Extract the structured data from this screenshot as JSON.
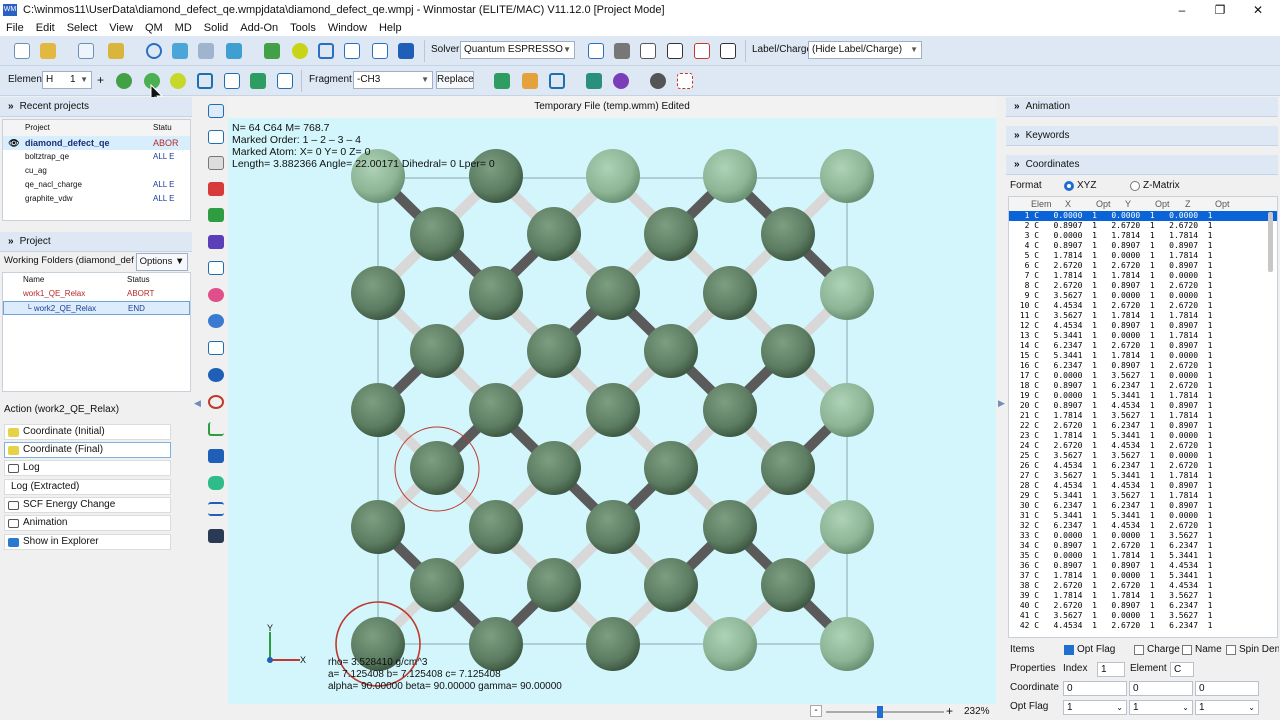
{
  "window": {
    "app_icon": "WM",
    "title": "C:\\winmos11\\UserData\\diamond_defect_qe.wmpjdata\\diamond_defect_qe.wmpj - Winmostar (ELITE/MAC) V11.12.0 [Project Mode]",
    "minimize": "–",
    "maximize": "❐",
    "close": "✕"
  },
  "menu": [
    "File",
    "Edit",
    "Select",
    "View",
    "QM",
    "MD",
    "Solid",
    "Add-On",
    "Tools",
    "Window",
    "Help"
  ],
  "toolbar1": {
    "solver_label": "Solver",
    "solver_value": "Quantum ESPRESSO",
    "label_charge_label": "Label/Charge",
    "label_charge_value": "(Hide Label/Charge)"
  },
  "toolbar2": {
    "element_label": "Element",
    "element_value": "H",
    "element_count": "1",
    "plus": "+",
    "fragment_label": "Fragment",
    "fragment_value": "-CH3",
    "replace_label": "Replace"
  },
  "recent_projects": {
    "header": "Recent projects",
    "col_project": "Project",
    "col_status": "Statu",
    "items": [
      {
        "name": "diamond_defect_qe",
        "status": "ABOR"
      },
      {
        "name": "boltztrap_qe",
        "status": "ALL E"
      },
      {
        "name": "cu_ag",
        "status": ""
      },
      {
        "name": "qe_nacl_charge",
        "status": "ALL E"
      },
      {
        "name": "graphite_vdw",
        "status": "ALL E"
      }
    ]
  },
  "project": {
    "header": "Project",
    "working_folders": "Working Folders (diamond_defe",
    "options": "Options ▼",
    "col_name": "Name",
    "col_status": "Status",
    "items": [
      {
        "name": "work1_QE_Relax",
        "status": "ABORT"
      },
      {
        "name": "└ work2_QE_Relax",
        "status": "END"
      }
    ]
  },
  "actions": {
    "header": "Action (work2_QE_Relax)",
    "items": [
      "Coordinate (Initial)",
      "Coordinate (Final)",
      "Log",
      "Log (Extracted)",
      "SCF Energy Change",
      "Animation",
      "Show in Explorer"
    ]
  },
  "viewport": {
    "title": "Temporary File (temp.wmm) Edited",
    "info_lines": [
      "N= 64  C64  M= 768.7",
      "Marked Order: 1 – 2 – 3 – 4",
      "Marked Atom:  X= 0  Y= 0  Z= 0",
      "Length= 3.882366  Angle= 22.00171  Dihedral= 0  Lper= 0"
    ],
    "cell_lines": [
      "rho= 3.528410 g/cm^3",
      "a= 7.125408  b= 7.125408  c= 7.125408",
      "alpha= 90.00000  beta= 90.00000  gamma= 90.00000"
    ],
    "axis_y": "Y",
    "axis_x": "X",
    "zoom": "232%",
    "zoom_minus": "-",
    "zoom_plus": "+",
    "zoom_fraction": 0.43
  },
  "right_panel": {
    "animation": "Animation",
    "keywords": "Keywords",
    "coordinates": "Coordinates",
    "format_label": "Format",
    "format_xyz": "XYZ",
    "format_zmatrix": "Z-Matrix",
    "table_headers": [
      "Elem",
      "X",
      "Opt",
      "Y",
      "Opt",
      "Z",
      "Opt"
    ],
    "rows": [
      [
        "1",
        "C",
        "0.0000",
        "0.0000",
        "0.0000"
      ],
      [
        "2",
        "C",
        "0.8907",
        "2.6720",
        "2.6720"
      ],
      [
        "3",
        "C",
        "0.0000",
        "1.7814",
        "1.7814"
      ],
      [
        "4",
        "C",
        "0.8907",
        "0.8907",
        "0.8907"
      ],
      [
        "5",
        "C",
        "1.7814",
        "0.0000",
        "1.7814"
      ],
      [
        "6",
        "C",
        "2.6720",
        "2.6720",
        "0.8907"
      ],
      [
        "7",
        "C",
        "1.7814",
        "1.7814",
        "0.0000"
      ],
      [
        "8",
        "C",
        "2.6720",
        "0.8907",
        "2.6720"
      ],
      [
        "9",
        "C",
        "3.5627",
        "0.0000",
        "0.0000"
      ],
      [
        "10",
        "C",
        "4.4534",
        "2.6720",
        "2.6720"
      ],
      [
        "11",
        "C",
        "3.5627",
        "1.7814",
        "1.7814"
      ],
      [
        "12",
        "C",
        "4.4534",
        "0.8907",
        "0.8907"
      ],
      [
        "13",
        "C",
        "5.3441",
        "0.0000",
        "1.7814"
      ],
      [
        "14",
        "C",
        "6.2347",
        "2.6720",
        "0.8907"
      ],
      [
        "15",
        "C",
        "5.3441",
        "1.7814",
        "0.0000"
      ],
      [
        "16",
        "C",
        "6.2347",
        "0.8907",
        "2.6720"
      ],
      [
        "17",
        "C",
        "0.0000",
        "3.5627",
        "0.0000"
      ],
      [
        "18",
        "C",
        "0.8907",
        "6.2347",
        "2.6720"
      ],
      [
        "19",
        "C",
        "0.0000",
        "5.3441",
        "1.7814"
      ],
      [
        "20",
        "C",
        "0.8907",
        "4.4534",
        "0.8907"
      ],
      [
        "21",
        "C",
        "1.7814",
        "3.5627",
        "1.7814"
      ],
      [
        "22",
        "C",
        "2.6720",
        "6.2347",
        "0.8907"
      ],
      [
        "23",
        "C",
        "1.7814",
        "5.3441",
        "0.0000"
      ],
      [
        "24",
        "C",
        "2.6720",
        "4.4534",
        "2.6720"
      ],
      [
        "25",
        "C",
        "3.5627",
        "3.5627",
        "0.0000"
      ],
      [
        "26",
        "C",
        "4.4534",
        "6.2347",
        "2.6720"
      ],
      [
        "27",
        "C",
        "3.5627",
        "5.3441",
        "1.7814"
      ],
      [
        "28",
        "C",
        "4.4534",
        "4.4534",
        "0.8907"
      ],
      [
        "29",
        "C",
        "5.3441",
        "3.5627",
        "1.7814"
      ],
      [
        "30",
        "C",
        "6.2347",
        "6.2347",
        "0.8907"
      ],
      [
        "31",
        "C",
        "5.3441",
        "5.3441",
        "0.0000"
      ],
      [
        "32",
        "C",
        "6.2347",
        "4.4534",
        "2.6720"
      ],
      [
        "33",
        "C",
        "0.0000",
        "0.0000",
        "3.5627"
      ],
      [
        "34",
        "C",
        "0.8907",
        "2.6720",
        "6.2347"
      ],
      [
        "35",
        "C",
        "0.0000",
        "1.7814",
        "5.3441"
      ],
      [
        "36",
        "C",
        "0.8907",
        "0.8907",
        "4.4534"
      ],
      [
        "37",
        "C",
        "1.7814",
        "0.0000",
        "5.3441"
      ],
      [
        "38",
        "C",
        "2.6720",
        "2.6720",
        "4.4534"
      ],
      [
        "39",
        "C",
        "1.7814",
        "1.7814",
        "3.5627"
      ],
      [
        "40",
        "C",
        "2.6720",
        "0.8907",
        "6.2347"
      ],
      [
        "41",
        "C",
        "3.5627",
        "0.0000",
        "3.5627"
      ],
      [
        "42",
        "C",
        "4.4534",
        "2.6720",
        "6.2347"
      ]
    ],
    "opt_flag_value": "1",
    "items_label": "Items",
    "opt_flag": "Opt Flag",
    "charge": "Charge",
    "name": "Name",
    "spin_dens": "Spin Dens",
    "properties_label": "Properties",
    "index_label": "Index",
    "index_value": "1",
    "element_label": "Element",
    "element_value": "C",
    "coordinate_label": "Coordinate",
    "coord_x": "0",
    "coord_y": "0",
    "coord_z": "0",
    "optflag_label": "Opt Flag",
    "optflag_x": "1",
    "optflag_y": "1",
    "optflag_z": "1"
  },
  "colors": {
    "atom": "#5d7d62",
    "atom_light": "#8db596",
    "bond_light": "#d8d8d8",
    "bond_dark": "#5a5a5a",
    "viewport_bg": "#d2f6fb",
    "selection": "#0a64d8",
    "marker": "#c0392b"
  }
}
